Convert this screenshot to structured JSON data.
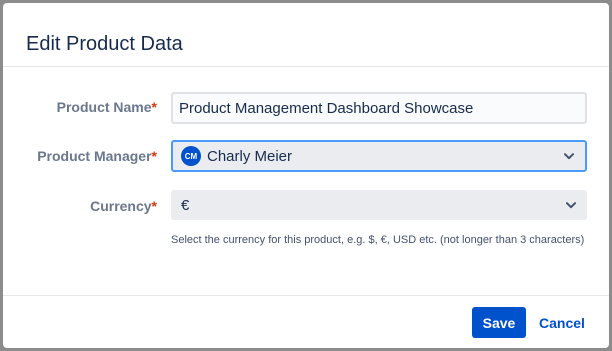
{
  "dialog": {
    "title": "Edit Product Data"
  },
  "form": {
    "product_name": {
      "label": "Product Name",
      "required_marker": "*",
      "value": "Product Management Dashboard Showcase"
    },
    "product_manager": {
      "label": "Product Manager",
      "required_marker": "*",
      "value": "Charly Meier",
      "avatar_initials": "CM",
      "icon": "chevron-down-icon"
    },
    "currency": {
      "label": "Currency",
      "required_marker": "*",
      "value": "€",
      "icon": "chevron-down-icon",
      "helper_text": "Select the currency for this product, e.g. $, €, USD etc. (not longer than 3 characters)"
    }
  },
  "footer": {
    "save_label": "Save",
    "cancel_label": "Cancel"
  },
  "colors": {
    "primary": "#0052cc",
    "required": "#de350b",
    "focus_border": "#4c9aff",
    "label": "#6b778c",
    "text": "#172b4d"
  }
}
